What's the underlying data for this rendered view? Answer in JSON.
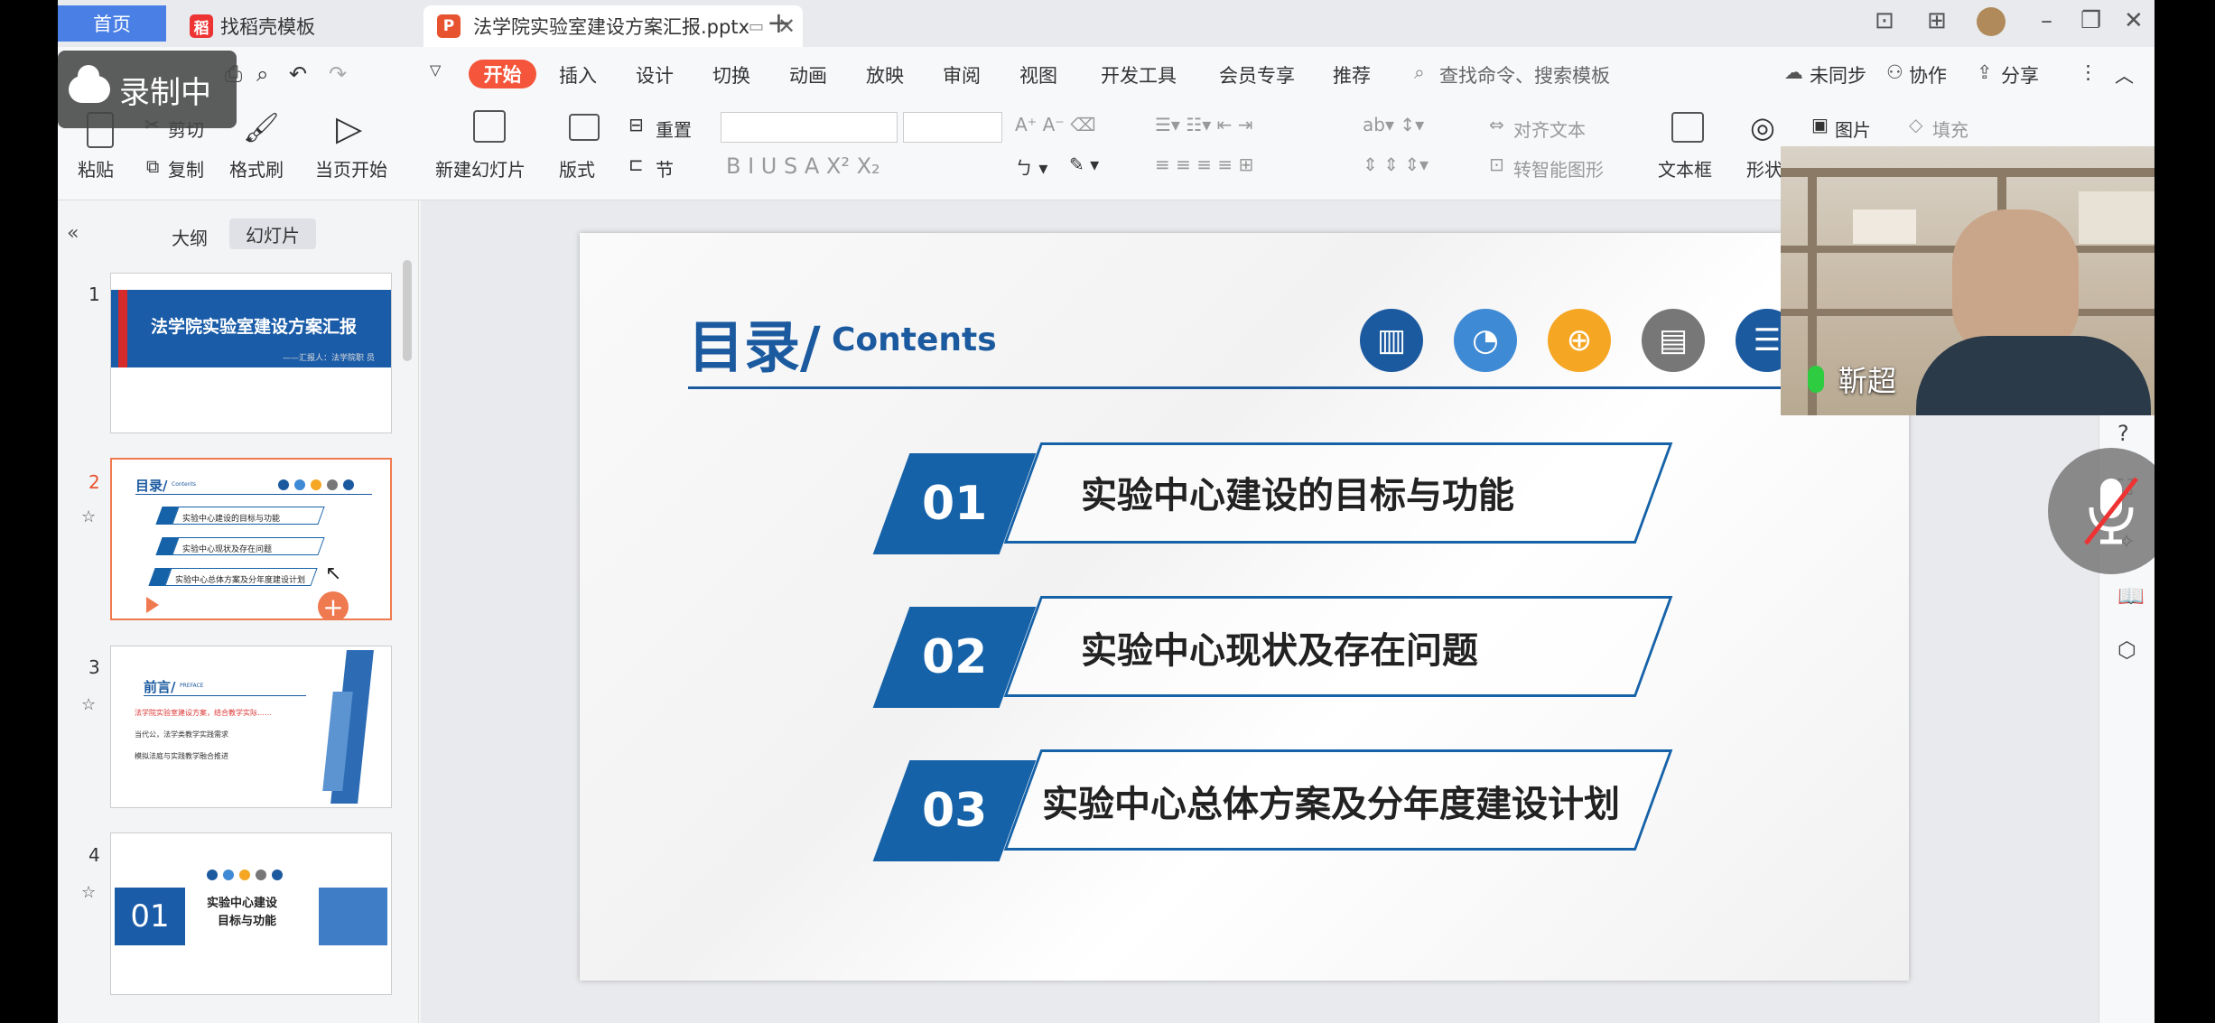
{
  "tabs": {
    "home": "首页",
    "template": "找稻壳模板",
    "file": "法学院实验室建设方案汇报.pptx"
  },
  "recording": "录制中",
  "menu": [
    "开始",
    "插入",
    "设计",
    "切换",
    "动画",
    "放映",
    "审阅",
    "视图",
    "开发工具",
    "会员专享",
    "推荐"
  ],
  "search_placeholder": "查找命令、搜索模板",
  "menu_right": {
    "sync": "未同步",
    "collab": "协作",
    "share": "分享"
  },
  "ribbon": {
    "paste": "粘贴",
    "cut": "剪切",
    "copy": "复制",
    "format_painter": "格式刷",
    "from_start": "当页开始",
    "new_slide": "新建幻灯片",
    "layout": "版式",
    "reset": "重置",
    "section": "节",
    "align_text": "对齐文本",
    "smart_shape": "转智能图形",
    "textbox": "文本框",
    "shape": "形状",
    "picture": "图片",
    "fill": "填充"
  },
  "panel": {
    "outline": "大纲",
    "slides": "幻灯片"
  },
  "thumbs": [
    {
      "num": "1",
      "title": "法学院实验室建设方案汇报",
      "reporter": "——汇报人：法学院职 员"
    },
    {
      "num": "2",
      "title": "目录/",
      "sub": "Contents",
      "items": [
        "实验中心建设的目标与功能",
        "实验中心现状及存在问题",
        "实验中心总体方案及分年度建设计划"
      ],
      "nums": [
        "01",
        "02",
        "03"
      ]
    },
    {
      "num": "3",
      "title": "前言/",
      "sub": "PREFACE",
      "line1": "法学院实验室建设方案，结合教学实际……",
      "line2": "当代公，法学类教学实践需求",
      "line3": "模拟法庭与实践教学融合推进"
    },
    {
      "num": "4",
      "big": "01",
      "t1": "实验中心建设",
      "t2": "目标与功能"
    }
  ],
  "slide": {
    "title": "目录/",
    "subtitle": "Contents",
    "items": [
      {
        "num": "01",
        "text": "实验中心建设的目标与功能"
      },
      {
        "num": "02",
        "text": "实验中心现状及存在问题"
      },
      {
        "num": "03",
        "text": "实验中心总体方案及分年度建设计划"
      }
    ]
  },
  "video": {
    "speaker": "靳超"
  },
  "colors": {
    "accent": "#1662a8",
    "start_tab": "#f4553b",
    "home_tab": "#4a7fe6"
  }
}
